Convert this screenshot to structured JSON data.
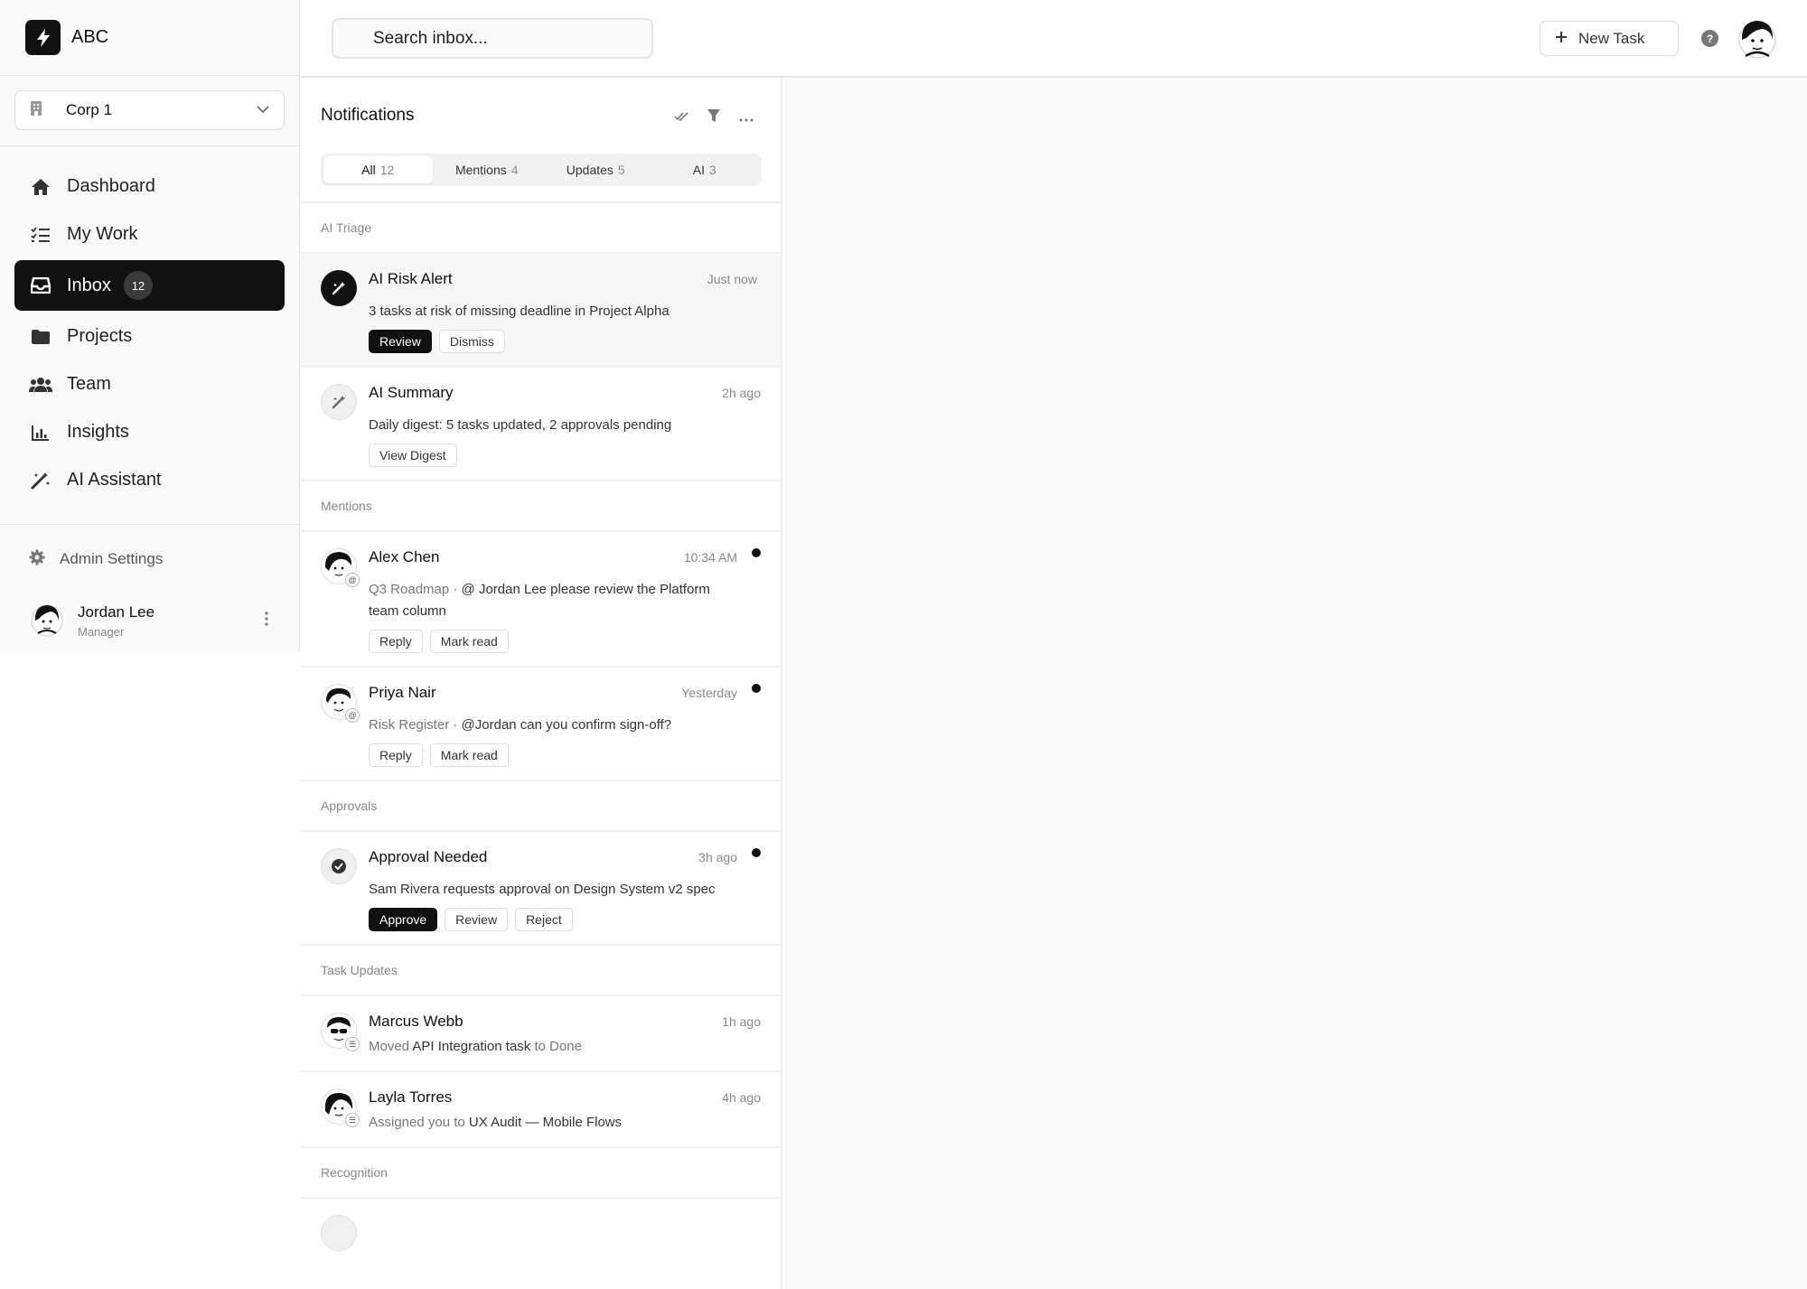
{
  "brand": {
    "name": "ABC"
  },
  "org": {
    "name": "Corp 1"
  },
  "nav": {
    "items": [
      {
        "label": "Dashboard"
      },
      {
        "label": "My Work"
      },
      {
        "label": "Inbox",
        "badge": "12"
      },
      {
        "label": "Projects"
      },
      {
        "label": "Team"
      },
      {
        "label": "Insights"
      },
      {
        "label": "AI Assistant"
      }
    ]
  },
  "admin": {
    "label": "Admin Settings"
  },
  "user": {
    "name": "Jordan Lee",
    "role": "Manager"
  },
  "topbar": {
    "search_placeholder": "Search inbox...",
    "new_task_label": "New Task",
    "help": "?"
  },
  "panel": {
    "title": "Notifications",
    "tabs": [
      {
        "label": "All",
        "count": "12"
      },
      {
        "label": "Mentions",
        "count": "4"
      },
      {
        "label": "Updates",
        "count": "5"
      },
      {
        "label": "AI",
        "count": "3"
      }
    ]
  },
  "sections": {
    "ai_triage": "AI Triage",
    "mentions": "Mentions",
    "approvals": "Approvals",
    "task_updates": "Task Updates",
    "recognition": "Recognition"
  },
  "notifications": {
    "risk": {
      "title": "AI Risk Alert",
      "time": "Just now",
      "desc": "3 tasks at risk of missing deadline in Project Alpha",
      "btn1": "Review",
      "btn2": "Dismiss"
    },
    "summary": {
      "title": "AI Summary",
      "time": "2h ago",
      "desc": "Daily digest: 5 tasks updated, 2 approvals pending",
      "btn1": "View Digest"
    },
    "alex": {
      "title": "Alex Chen",
      "time": "10:34 AM",
      "context": "Q3 Roadmap · ",
      "desc": "@ Jordan Lee please review the Platform team column",
      "btn1": "Reply",
      "btn2": "Mark read"
    },
    "priya": {
      "title": "Priya Nair",
      "time": "Yesterday",
      "context": "Risk Register · ",
      "desc": "@Jordan can you confirm sign-off?",
      "btn1": "Reply",
      "btn2": "Mark read"
    },
    "approval": {
      "title": "Approval Needed",
      "time": "3h ago",
      "desc": "Sam Rivera requests approval on Design System v2 spec",
      "btn1": "Approve",
      "btn2": "Review",
      "btn3": "Reject"
    },
    "marcus": {
      "title": "Marcus Webb",
      "time": "1h ago",
      "pre": "Moved ",
      "strong": "API Integration task",
      "post": " to Done"
    },
    "layla": {
      "title": "Layla Torres",
      "time": "4h ago",
      "pre": "Assigned you to ",
      "strong": "UX Audit — Mobile Flows"
    }
  }
}
